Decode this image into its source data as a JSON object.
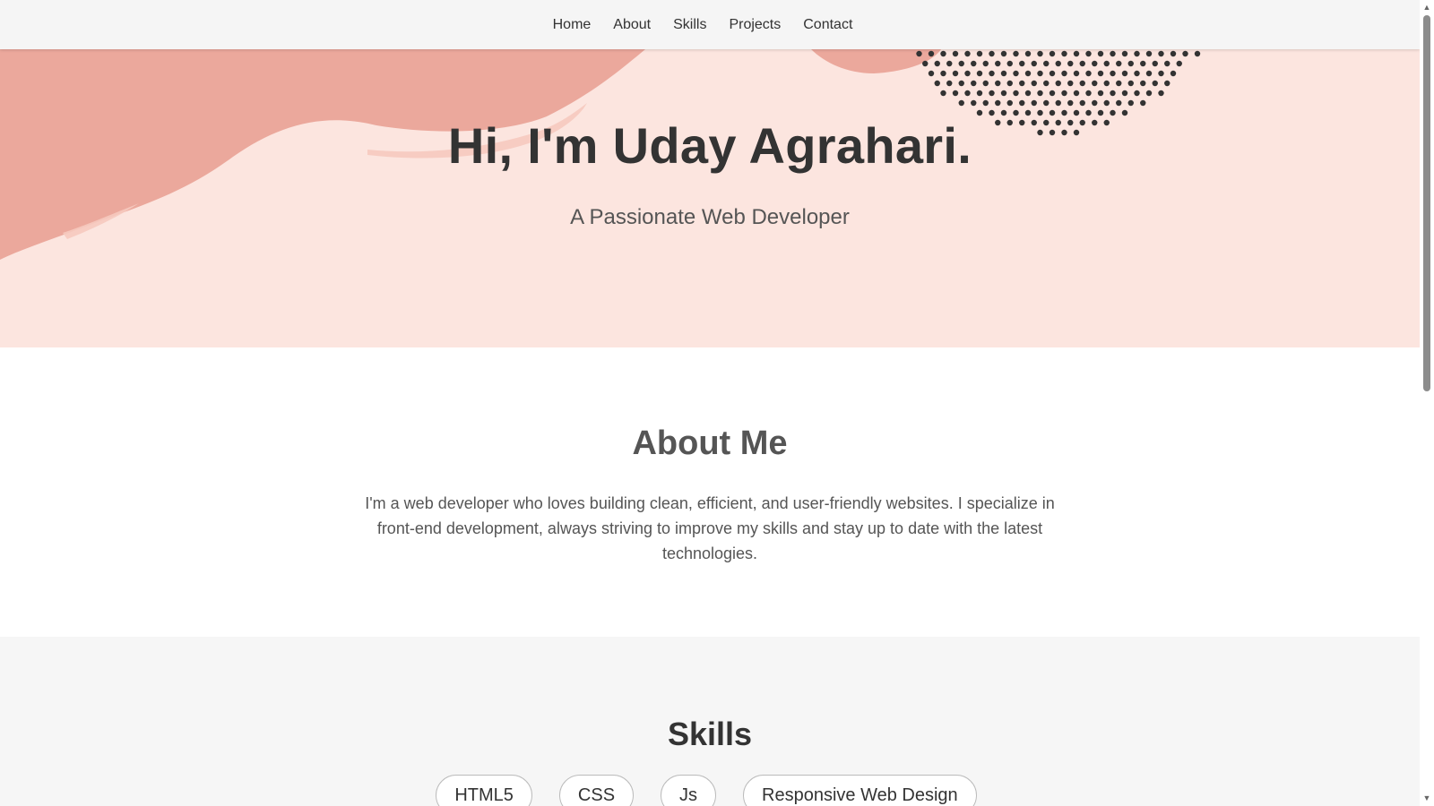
{
  "nav": {
    "items": [
      {
        "label": "Home"
      },
      {
        "label": "About"
      },
      {
        "label": "Skills"
      },
      {
        "label": "Projects"
      },
      {
        "label": "Contact"
      }
    ]
  },
  "hero": {
    "title": "Hi, I'm Uday Agrahari.",
    "subtitle": "A Passionate Web Developer"
  },
  "about": {
    "title": "About Me",
    "text": "I'm a web developer who loves building clean, efficient, and user-friendly websites. I specialize in front-end development, always striving to improve my skills and stay up to date with the latest technologies."
  },
  "skills": {
    "title": "Skills",
    "items": [
      "HTML5",
      "CSS",
      "Js",
      "Responsive Web Design"
    ]
  },
  "colors": {
    "hero_bg": "#fce5df",
    "accent_salmon": "#eba89c",
    "dots": "#333333",
    "nav_bg": "#f5f5f5",
    "skills_bg": "#f6f6f6"
  },
  "icons": {
    "scroll_up": "triangle-up-icon",
    "scroll_down": "triangle-down-icon"
  }
}
